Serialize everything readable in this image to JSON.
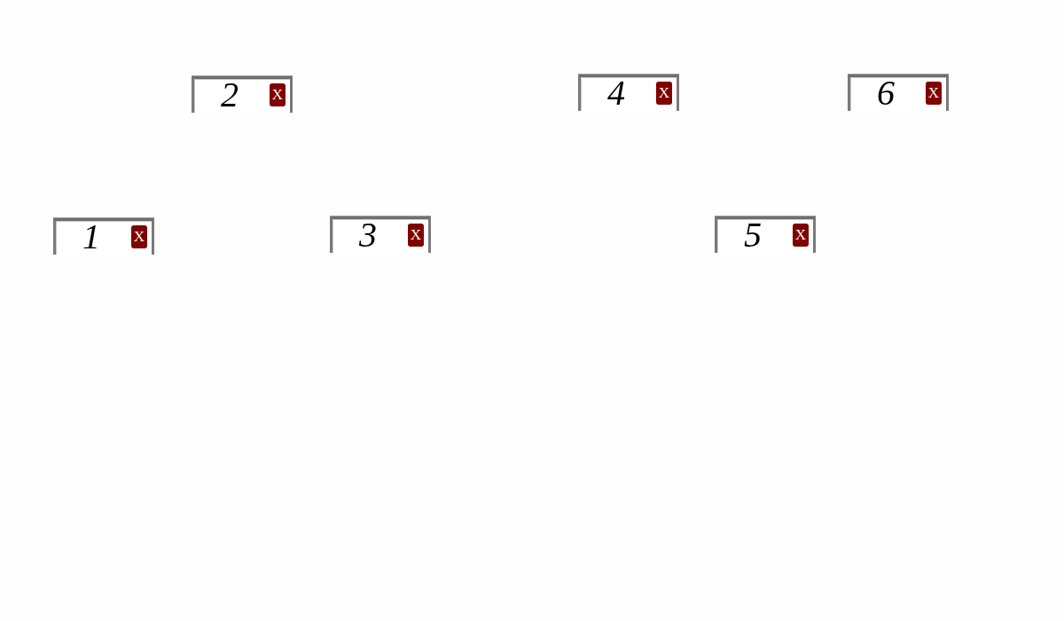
{
  "tiles": [
    {
      "number": "1",
      "close": "X"
    },
    {
      "number": "2",
      "close": "X"
    },
    {
      "number": "3",
      "close": "X"
    },
    {
      "number": "4",
      "close": "X"
    },
    {
      "number": "5",
      "close": "X"
    },
    {
      "number": "6",
      "close": "X"
    }
  ]
}
